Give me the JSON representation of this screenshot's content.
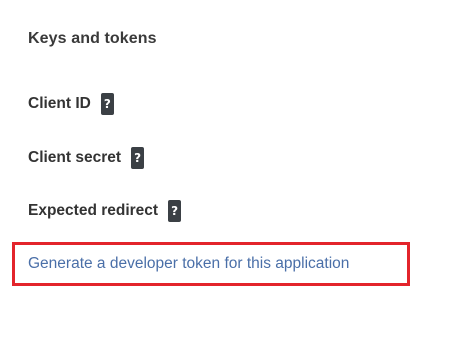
{
  "section": {
    "title": "Keys and tokens"
  },
  "fields": [
    {
      "label": "Client ID",
      "help": "?"
    },
    {
      "label": "Client secret",
      "help": "?"
    },
    {
      "label": "Expected redirect",
      "help": "?"
    }
  ],
  "generate_link": {
    "label": "Generate a developer token for this application"
  },
  "colors": {
    "highlight_border": "#e3242b",
    "link": "#4a6fa8",
    "help_badge_bg": "#3b4045"
  }
}
